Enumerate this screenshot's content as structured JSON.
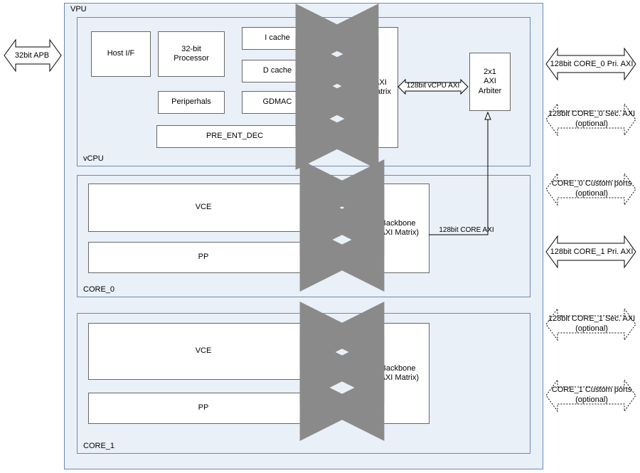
{
  "vpu": {
    "title": "VPU"
  },
  "vcpu": {
    "title": "vCPU",
    "host_if": "Host I/F",
    "proc": "32-bit\nProcessor",
    "periph": "Periperhals",
    "icache": "I cache",
    "dcache": "D cache",
    "gdmac": "GDMAC",
    "pre_ent_dec": "PRE_ENT_DEC",
    "axi_matrix": "AXI\nMatrix",
    "arbiter": "2x1\nAXI\nArbiter",
    "vcpu_axi": "128bit vCPU AXI"
  },
  "core0": {
    "title": "CORE_0",
    "vce": "VCE",
    "pp": "PP",
    "backbone_l1": "Backbone",
    "backbone_l2": "(AXI Matrix)",
    "core_axi": "128bit CORE AXI"
  },
  "core1": {
    "title": "CORE_1",
    "vce": "VCE",
    "pp": "PP",
    "backbone_l1": "Backbone",
    "backbone_l2": "(AXI Matrix)"
  },
  "ext": {
    "apb": "32bit APB",
    "c0_pri": "128bit CORE_0 Pri. AXI",
    "c0_sec_l1": "128bit CORE_0 Sec. AXI",
    "c0_sec_l2": "(optional)",
    "c0_custom_l1": "CORE_0 Custom ports",
    "c0_custom_l2": "(optional)",
    "c1_pri": "128bit CORE_1 Pri. AXI",
    "c1_sec_l1": "128bit CORE_1 Sec. AXI",
    "c1_sec_l2": "(optional)",
    "c1_custom_l1": "CORE_1 Custom ports",
    "c1_custom_l2": "(optional)"
  }
}
